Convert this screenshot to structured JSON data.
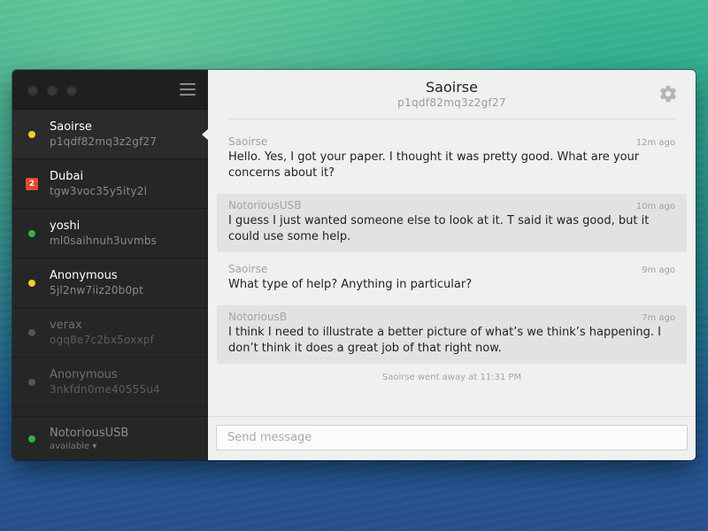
{
  "window": {
    "header": {
      "title": "Saoirse",
      "subtitle": "p1qdf82mq3z2gf27"
    },
    "sidebar": {
      "contacts": [
        {
          "name": "Saoirse",
          "id": "p1qdf82mq3z2gf27",
          "status": "yellow",
          "active": true
        },
        {
          "name": "Dubai",
          "id": "tgw3voc35y5ity2l",
          "badge": "2"
        },
        {
          "name": "yoshi",
          "id": "ml0saihnuh3uvmbs",
          "status": "green"
        },
        {
          "name": "Anonymous",
          "id": "5jl2nw7iiz20b0pt",
          "status": "yellow"
        },
        {
          "name": "verax",
          "id": "ogq8e7c2bx5oxxpf",
          "status": "gray"
        },
        {
          "name": "Anonymous",
          "id": "3nkfdn0me40555u4",
          "status": "gray"
        }
      ],
      "me": {
        "name": "NotoriousUSB",
        "status_label": "available ▾",
        "status": "green"
      }
    },
    "messages": [
      {
        "sender": "Saoirse",
        "time": "12m ago",
        "text": "Hello. Yes, I got your paper. I thought it was pretty good. What are your concerns about it?"
      },
      {
        "sender": "NotoriousUSB",
        "time": "10m ago",
        "text": "I guess I just wanted someone else to look at it. T said it was good, but it could use some help."
      },
      {
        "sender": "Saoirse",
        "time": "9m ago",
        "text": "What type of help? Anything in particular?"
      },
      {
        "sender": "NotoriousB",
        "time": "7m ago",
        "text": "I think I need to illustrate a better picture of what’s we think’s happening. I don’t think it does a great job of that right now."
      }
    ],
    "notice": "Saoirse went away at 11:31 PM",
    "composer": {
      "placeholder": "Send message",
      "value": ""
    }
  },
  "colors": {
    "status_yellow": "#f3cd2f",
    "status_green": "#2fb53a",
    "badge_red": "#e04c2a",
    "sidebar_bg": "#262626",
    "main_bg": "#f0f0f0"
  }
}
